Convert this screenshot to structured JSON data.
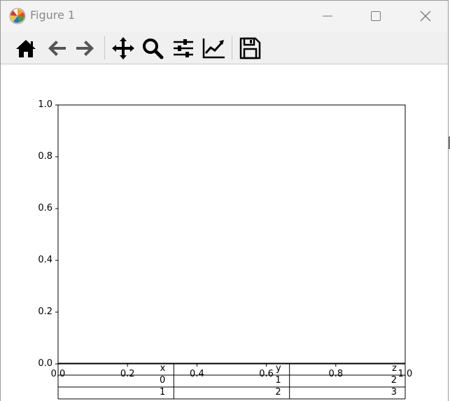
{
  "window": {
    "title": "Figure 1"
  },
  "titlebar_buttons": [
    "minimize-icon",
    "maximize-icon",
    "close-icon"
  ],
  "toolbar": {
    "buttons": [
      "home-icon",
      "back-arrow-icon",
      "forward-arrow-icon",
      "pan-icon",
      "zoom-icon",
      "configure-subplots-icon",
      "edit-axis-icon",
      "save-icon"
    ]
  },
  "chart_data": {
    "type": "table",
    "xlim": [
      0.0,
      1.0
    ],
    "ylim": [
      0.0,
      1.0
    ],
    "x_ticks": [
      "0.0",
      "0.2",
      "0.4",
      "0.6",
      "0.8",
      "1.0"
    ],
    "y_ticks": [
      "0.0",
      "0.2",
      "0.4",
      "0.6",
      "0.8",
      "1.0"
    ],
    "table": {
      "columns": [
        "x",
        "y",
        "z"
      ],
      "rows": [
        [
          "0",
          "1",
          "2"
        ],
        [
          "1",
          "2",
          "3"
        ]
      ]
    }
  },
  "colors": {
    "titlebar_bg": "#f3f3f3",
    "toolbar_bg": "#f0f0f0",
    "icon_color": "#000000",
    "title_text": "#8a8a8a"
  }
}
